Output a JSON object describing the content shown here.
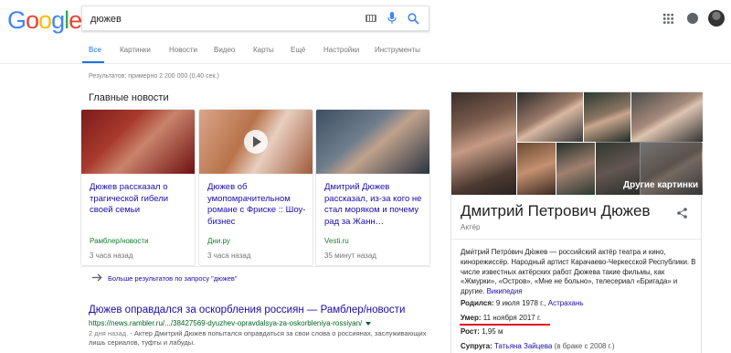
{
  "logo": {
    "letters": [
      "G",
      "o",
      "o",
      "g",
      "l",
      "e"
    ],
    "colors": [
      "#4285f4",
      "#ea4335",
      "#fbbc05",
      "#4285f4",
      "#34a853",
      "#ea4335"
    ]
  },
  "search": {
    "query": "дюжев"
  },
  "tabs": [
    {
      "label": "Все",
      "active": true
    },
    {
      "label": "Картинки"
    },
    {
      "label": "Новости"
    },
    {
      "label": "Видео"
    },
    {
      "label": "Карты"
    },
    {
      "label": "Ещё"
    },
    {
      "label": "Настройки"
    },
    {
      "label": "Инструменты"
    }
  ],
  "result_stats": "Результатов: примерно 2 200 000 (0,40 сек.)",
  "news": {
    "heading": "Главные новости",
    "cards": [
      {
        "title": "Дюжев рассказал о трагической гибели своей семьи",
        "source": "Рамблер/новости",
        "time": "3 часа назад"
      },
      {
        "title": "Дюжев об умопомрачительном романе с Фриске :: Шоу-бизнес",
        "source": "Дни.ру",
        "time": "3 часа назад"
      },
      {
        "title": "Дмитрий Дюжев рассказал, из-за кого не стал моряком и почему рад за Жанн…",
        "source": "Vesti.ru",
        "time": "35 минут назад"
      }
    ],
    "more": "Больше результатов по запросу \"дюжев\""
  },
  "result": {
    "title": "Дюжев оправдался за оскорбления россиян — Рамблер/новости",
    "url": "https://news.rambler.ru/.../38427569-dyuzhev-opravdalsya-za-oskorbleniya-rossiyan/",
    "date": "2 дня назад.",
    "snippet": " - Актер Дмитрий Дюжев попытался оправдаться за свои слова о россиянах, заслуживающих лишь сериалов, туфты и лабуды."
  },
  "kp": {
    "name": "Дмитрий Петрович Дюжев",
    "type": "Актёр",
    "more_images": "Другие картинки",
    "description": "Дми́трий Петро́вич Дю́жев — российский актёр театра и кино, кинорежиссёр. Народный артист Карачаево-Черкесской Республики. В числе известных актёрских работ Дюжева такие фильмы, как «Жмурки», «Остров», «Мне не больно», телесериал «Бригада» и другие.",
    "wiki": "Википедия",
    "facts": {
      "born_label": "Родился:",
      "born_value": "9 июля 1978 г.,",
      "born_place": "Астрахань",
      "died_label": "Умер:",
      "died_value": "11 ноября 2017 г.",
      "height_label": "Рост:",
      "height_value": "1,95 м",
      "spouse_label": "Супруга:",
      "spouse_value": "Татьяна Зайцева",
      "spouse_note": "(в браке с 2008 г.)"
    },
    "highlight_color": "#e0101a"
  },
  "accent_color": "#1a73e8",
  "link_color": "#1a0dab"
}
